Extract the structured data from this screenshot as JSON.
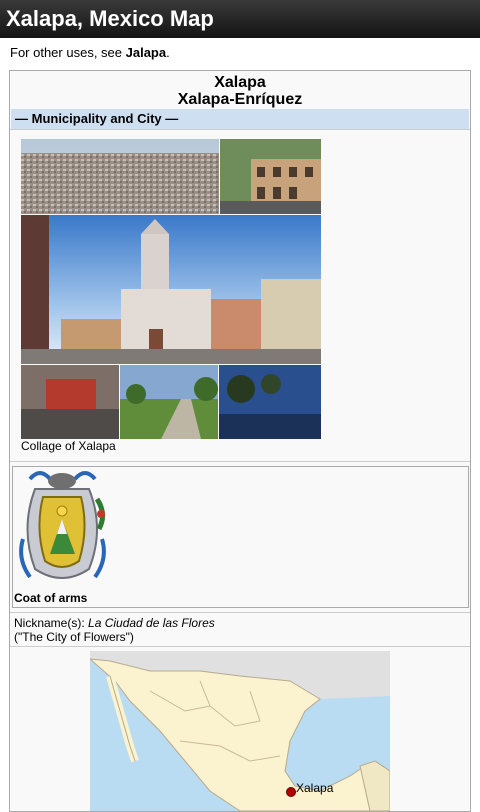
{
  "app": {
    "title": "Xalapa, Mexico Map"
  },
  "hatnote": {
    "prefix": "For other uses, see ",
    "link": "Jalapa",
    "suffix": "."
  },
  "infobox": {
    "name": "Xalapa",
    "official_name": "Xalapa-Enríquez",
    "subheader": "—  Municipality and City  —",
    "image_caption": "Collage of Xalapa",
    "coat_of_arms_label": "Coat of arms",
    "nickname": {
      "label": "Nickname(s): ",
      "value": "La Ciudad de las Flores",
      "translation": "(\"The City of Flowers\")"
    },
    "map_label": "Xalapa"
  },
  "colors": {
    "titlebar": "#1c1c1c",
    "subheader_bg": "#cedff2",
    "infobox_bg": "#f9f9f9",
    "map_marker": "#b30000"
  }
}
